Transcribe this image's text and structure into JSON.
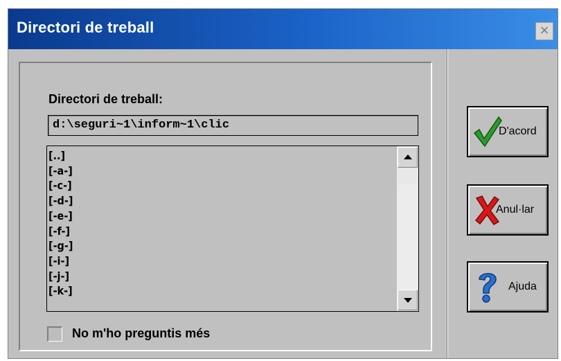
{
  "window": {
    "title": "Directori de treball",
    "close_label": "×"
  },
  "working_dir": {
    "label": "Directori de treball:",
    "path": "d:\\seguri~1\\inform~1\\clic"
  },
  "list": {
    "items": [
      "[..]",
      "[-a-]",
      "[-c-]",
      "[-d-]",
      "[-e-]",
      "[-f-]",
      "[-g-]",
      "[-i-]",
      "[-j-]",
      "[-k-]"
    ],
    "scroll_up_icon": "arrow-up-icon",
    "scroll_down_icon": "arrow-down-icon"
  },
  "checkbox": {
    "label": "No m'ho preguntis més",
    "checked": false
  },
  "buttons": {
    "ok": {
      "label": "D'acord",
      "icon": "green-checkmark-icon"
    },
    "cancel": {
      "label": "Anul·lar",
      "icon": "red-x-icon"
    },
    "help": {
      "label": "Ajuda",
      "icon": "blue-question-mark-icon"
    }
  },
  "colors": {
    "titlebar_start": "#0a3a8e",
    "titlebar_end": "#3a8ee6",
    "face": "#c0c0c0",
    "check_green": "#2e9a2e",
    "cancel_red": "#d81818",
    "help_blue": "#2a6fd0"
  }
}
